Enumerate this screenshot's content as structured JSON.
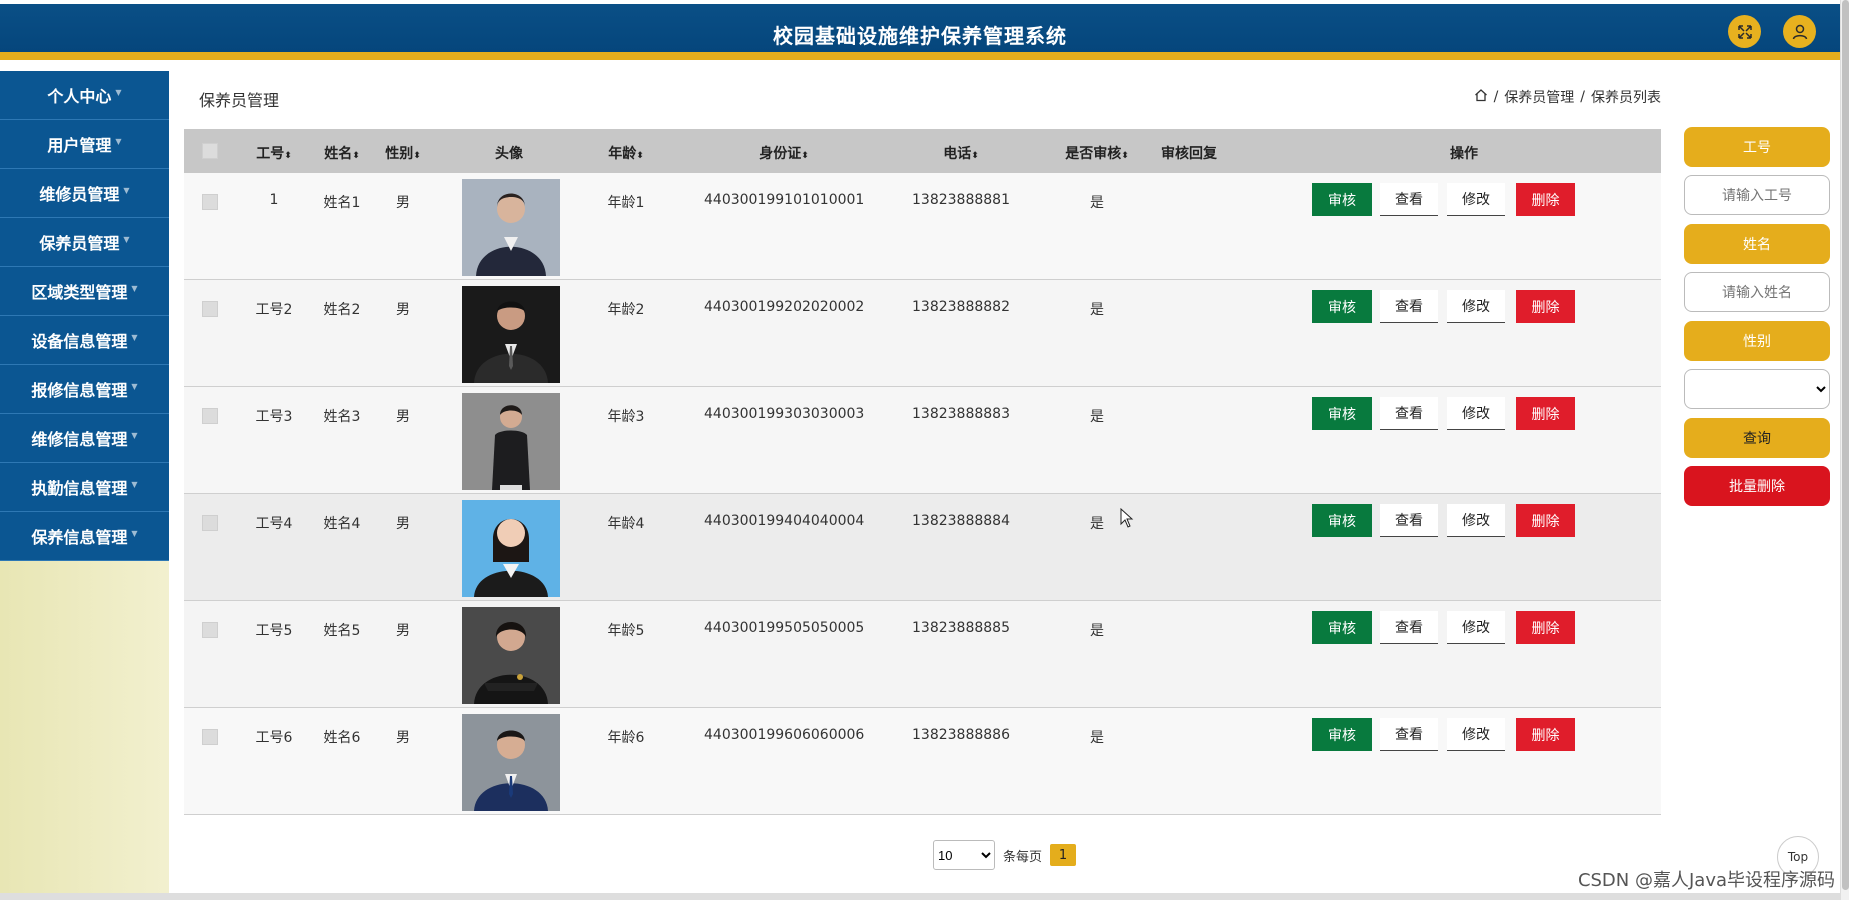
{
  "header": {
    "title": "校园基础设施维护保养管理系统",
    "icons": [
      "fullscreen-icon",
      "user-icon"
    ]
  },
  "sidebar": {
    "items": [
      {
        "label": "个人中心"
      },
      {
        "label": "用户管理"
      },
      {
        "label": "维修员管理"
      },
      {
        "label": "保养员管理"
      },
      {
        "label": "区域类型管理"
      },
      {
        "label": "设备信息管理"
      },
      {
        "label": "报修信息管理"
      },
      {
        "label": "维修信息管理"
      },
      {
        "label": "执勤信息管理"
      },
      {
        "label": "保养信息管理"
      }
    ]
  },
  "page": {
    "title": "保养员管理"
  },
  "breadcrumb": {
    "items": [
      "保养员管理",
      "保养员列表"
    ],
    "separator": "/"
  },
  "table": {
    "headers": {
      "id": "工号",
      "name": "姓名",
      "gender": "性别",
      "avatar": "头像",
      "age": "年龄",
      "idcard": "身份证",
      "phone": "电话",
      "audited": "是否审核",
      "reply": "审核回复",
      "actions": "操作"
    },
    "sort_glyph": "⬍",
    "rows": [
      {
        "id": "1",
        "name": "姓名1",
        "gender": "男",
        "age": "年龄1",
        "idcard": "440300199101010001",
        "phone": "13823888881",
        "audited": "是",
        "reply": ""
      },
      {
        "id": "工号2",
        "name": "姓名2",
        "gender": "男",
        "age": "年龄2",
        "idcard": "440300199202020002",
        "phone": "13823888882",
        "audited": "是",
        "reply": ""
      },
      {
        "id": "工号3",
        "name": "姓名3",
        "gender": "男",
        "age": "年龄3",
        "idcard": "440300199303030003",
        "phone": "13823888883",
        "audited": "是",
        "reply": ""
      },
      {
        "id": "工号4",
        "name": "姓名4",
        "gender": "男",
        "age": "年龄4",
        "idcard": "440300199404040004",
        "phone": "13823888884",
        "audited": "是",
        "reply": ""
      },
      {
        "id": "工号5",
        "name": "姓名5",
        "gender": "男",
        "age": "年龄5",
        "idcard": "440300199505050005",
        "phone": "13823888885",
        "audited": "是",
        "reply": ""
      },
      {
        "id": "工号6",
        "name": "姓名6",
        "gender": "男",
        "age": "年龄6",
        "idcard": "440300199606060006",
        "phone": "13823888886",
        "audited": "是",
        "reply": ""
      }
    ],
    "actions": {
      "audit": "审核",
      "view": "查看",
      "edit": "修改",
      "delete": "删除"
    }
  },
  "pagination": {
    "page_size": "10",
    "page_size_options": [
      "10"
    ],
    "per_page_label": "条每页",
    "current_page": "1"
  },
  "search_panel": {
    "id_label": "工号",
    "id_placeholder": "请输入工号",
    "name_label": "姓名",
    "name_placeholder": "请输入姓名",
    "gender_label": "性别",
    "gender_value": "",
    "search_button": "查询",
    "batch_delete_button": "批量删除"
  },
  "back_to_top": "Top",
  "watermark": "CSDN @嘉人Java毕设程序源码",
  "colors": {
    "header": "#0a4f86",
    "accent": "#e5ad1c",
    "sidebar": "#0b5692",
    "audit": "#087a3e",
    "delete": "#e01d2b"
  }
}
